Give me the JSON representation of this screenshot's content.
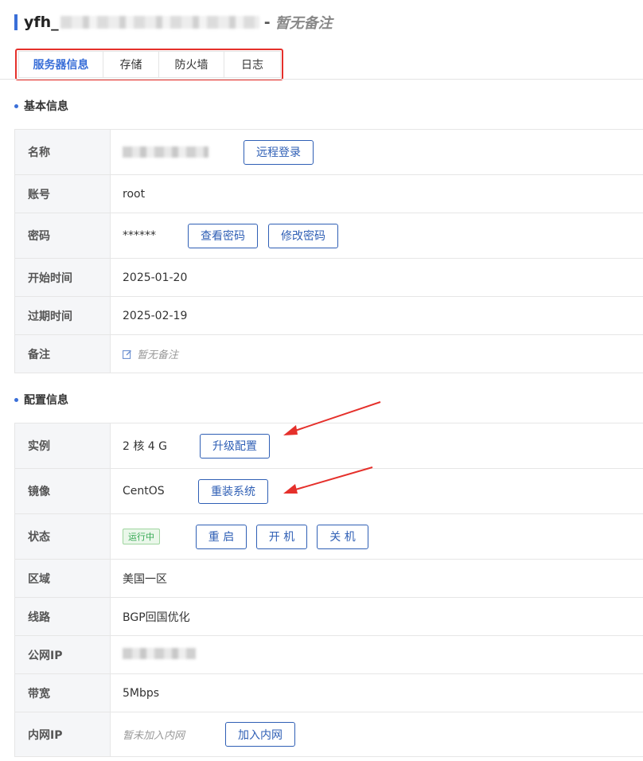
{
  "header": {
    "server_name_prefix": "yfh_",
    "separator": "-",
    "remark": "暂无备注"
  },
  "tabs": [
    {
      "label": "服务器信息",
      "active": true
    },
    {
      "label": "存储",
      "active": false
    },
    {
      "label": "防火墙",
      "active": false
    },
    {
      "label": "日志",
      "active": false
    }
  ],
  "basic_info": {
    "section_title": "基本信息",
    "name_label": "名称",
    "remote_login_button": "远程登录",
    "account_label": "账号",
    "account_value": "root",
    "password_label": "密码",
    "password_value": "******",
    "view_password_button": "查看密码",
    "change_password_button": "修改密码",
    "start_time_label": "开始时间",
    "start_time_value": "2025-01-20",
    "expire_time_label": "过期时间",
    "expire_time_value": "2025-02-19",
    "remark_label": "备注",
    "remark_value": "暂无备注"
  },
  "config_info": {
    "section_title": "配置信息",
    "instance_label": "实例",
    "instance_value": "2 核 4 G",
    "upgrade_button": "升级配置",
    "image_label": "镜像",
    "image_value": "CentOS",
    "reinstall_button": "重装系统",
    "status_label": "状态",
    "status_value": "运行中",
    "restart_button": "重 启",
    "power_on_button": "开 机",
    "power_off_button": "关 机",
    "region_label": "区域",
    "region_value": "美国一区",
    "line_label": "线路",
    "line_value": "BGP回国优化",
    "public_ip_label": "公网IP",
    "bandwidth_label": "带宽",
    "bandwidth_value": "5Mbps",
    "private_ip_label": "内网IP",
    "private_ip_value": "暂未加入内网",
    "join_network_button": "加入内网"
  },
  "colors": {
    "accent": "#3a6fd8",
    "button": "#2f5fb5",
    "highlight_red": "#e5302b",
    "status_green": "#34a853"
  }
}
